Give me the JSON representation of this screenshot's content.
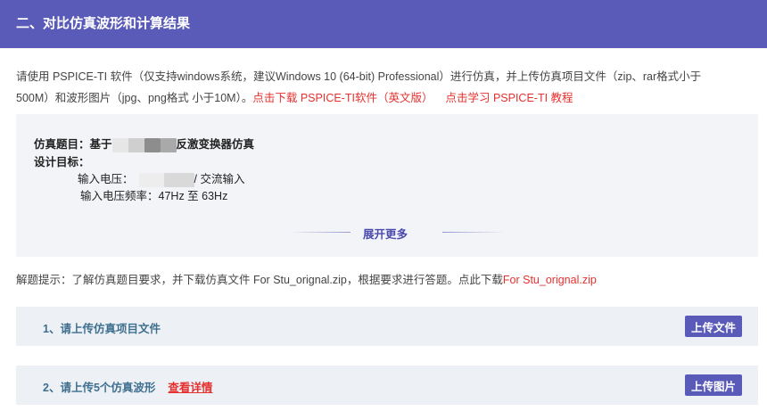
{
  "header": {
    "title": "二、对比仿真波形和计算结果"
  },
  "intro": {
    "text_line1": "请使用 PSPICE-TI 软件（仅支持windows系统，建议Windows 10 (64-bit) Professional）进行仿真，并上传仿真项目文件（zip、rar格式小于",
    "text_line2": "500M）和波形图片（jpg、png格式 小于10M）。",
    "download_link": "点击下载 PSPICE-TI软件（英文版）",
    "tutorial_link": "点击学习 PSPICE-TI 教程"
  },
  "info": {
    "title_label": "仿真题目：",
    "title_prefix": "基于",
    "title_suffix": "反激变换器仿真",
    "goal_label": "设计目标：",
    "input_voltage_label": "输入电压：",
    "input_voltage_suffix": "/ 交流输入",
    "freq_label": "输入电压频率：",
    "freq_value": "47Hz 至 63Hz",
    "expand_label": "展开更多"
  },
  "hint": {
    "text": "解题提示：了解仿真题目要求，并下载仿真文件 For Stu_orignal.zip，根据要求进行答题。点此下载",
    "link": "For Stu_orignal.zip"
  },
  "tasks": [
    {
      "label": "1、请上传仿真项目文件",
      "button": "上传文件"
    },
    {
      "label": "2、请上传5个仿真波形",
      "link": "查看详情",
      "button": "上传图片"
    }
  ]
}
